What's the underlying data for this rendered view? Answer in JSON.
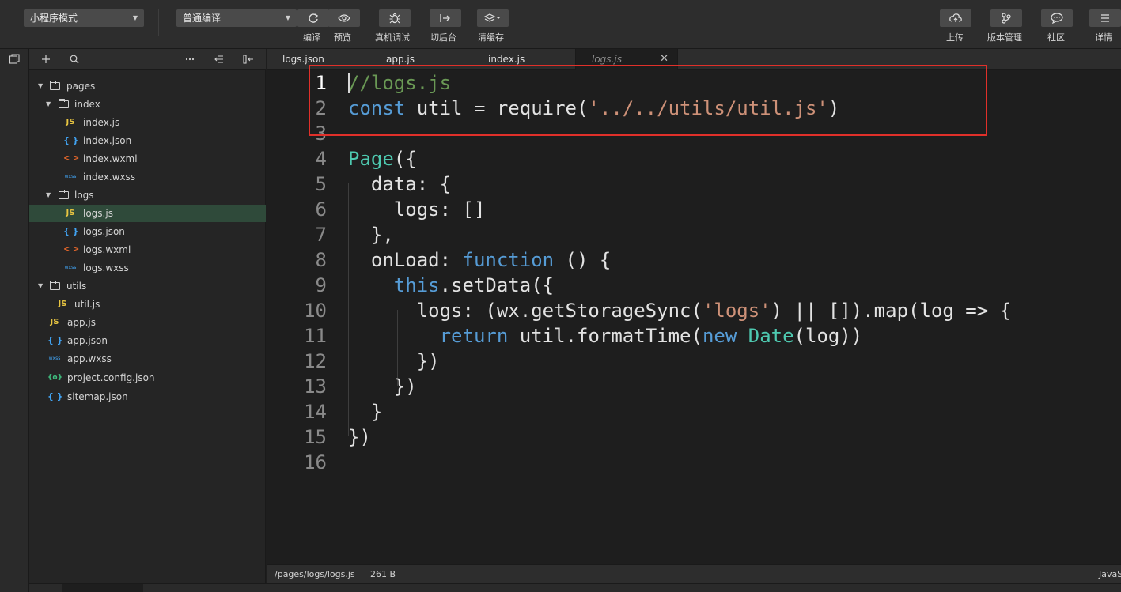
{
  "toolbar": {
    "mode_select": "小程序模式",
    "compile_select": "普通编译",
    "buttons": {
      "compile": "编译",
      "preview": "预览",
      "debug": "真机调试",
      "background": "切后台",
      "clear_cache": "清缓存",
      "upload": "上传",
      "version": "版本管理",
      "community": "社区",
      "details": "详情"
    }
  },
  "tree": {
    "items": [
      {
        "label": "pages"
      },
      {
        "label": "index"
      },
      {
        "label": "index.js"
      },
      {
        "label": "index.json"
      },
      {
        "label": "index.wxml"
      },
      {
        "label": "index.wxss"
      },
      {
        "label": "logs"
      },
      {
        "label": "logs.js"
      },
      {
        "label": "logs.json"
      },
      {
        "label": "logs.wxml"
      },
      {
        "label": "logs.wxss"
      },
      {
        "label": "utils"
      },
      {
        "label": "util.js"
      },
      {
        "label": "app.js"
      },
      {
        "label": "app.json"
      },
      {
        "label": "app.wxss"
      },
      {
        "label": "project.config.json"
      },
      {
        "label": "sitemap.json"
      }
    ],
    "icons": {
      "js": "JS",
      "json": "{ }",
      "wxml": "< >",
      "wxss": "wxss",
      "config": "{o}"
    }
  },
  "tabs": [
    {
      "label": "logs.json"
    },
    {
      "label": "app.js"
    },
    {
      "label": "index.js"
    },
    {
      "label": "logs.js"
    }
  ],
  "editor": {
    "line_numbers": [
      "1",
      "2",
      "3",
      "4",
      "5",
      "6",
      "7",
      "8",
      "9",
      "10",
      "11",
      "12",
      "13",
      "14",
      "15",
      "16"
    ],
    "lines": {
      "l1": {
        "comment": "//logs.js"
      },
      "l2": {
        "kw": "const",
        "mid": " util = require(",
        "str": "'../../utils/util.js'",
        "end": ")"
      },
      "l4": {
        "type": "Page",
        "rest": "({"
      },
      "l5": {
        "text": "  data: {"
      },
      "l6": {
        "text": "    logs: []"
      },
      "l7": {
        "text": "  },"
      },
      "l8": {
        "a": "  onLoad: ",
        "kw": "function",
        "b": " () {"
      },
      "l9": {
        "ind": "    ",
        "kw": "this",
        "rest": ".setData({"
      },
      "l10": {
        "a": "      logs: (wx.getStorageSync(",
        "str": "'logs'",
        "b": ") || []).map(log => {"
      },
      "l11": {
        "ind": "        ",
        "kw": "return",
        "a": " util.formatTime(",
        "kw2": "new",
        "sp": " ",
        "type": "Date",
        "b": "(log))"
      },
      "l12": {
        "text": "      })"
      },
      "l13": {
        "text": "    })"
      },
      "l14": {
        "text": "  }"
      },
      "l15": {
        "text": "})"
      }
    }
  },
  "status": {
    "path": "/pages/logs/logs.js",
    "size": "261 B",
    "language": "JavaScript"
  },
  "colors": {
    "highlight_box": "#e0302a",
    "selected_row": "#2f4a3a"
  }
}
